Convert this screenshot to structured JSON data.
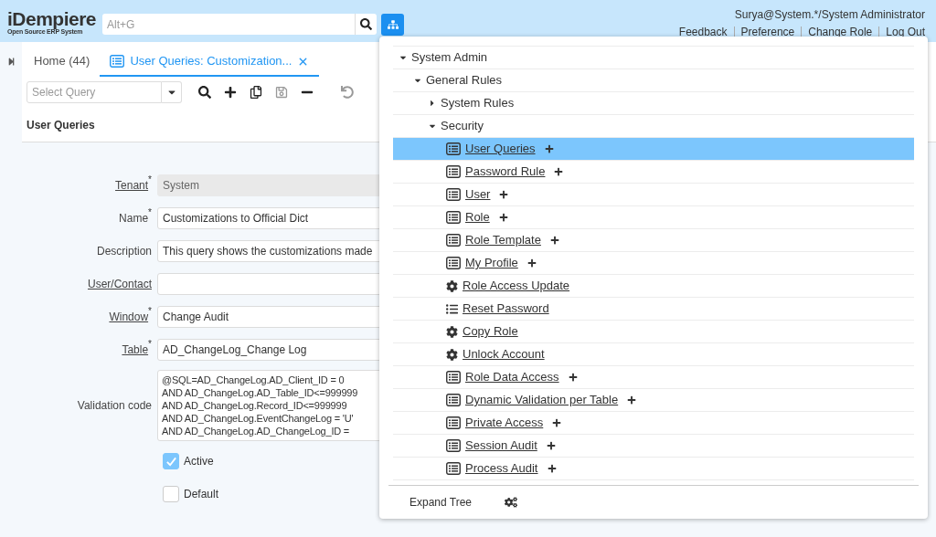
{
  "header": {
    "logo": "iDempiere",
    "logo_subtitle": "Open Source ERP System",
    "search": {
      "placeholder": "Alt+G"
    },
    "user": "Surya@System.*/System Administrator",
    "links": [
      "Feedback",
      "Preference",
      "Change Role",
      "Log Out"
    ]
  },
  "tabs": [
    {
      "label": "Home (44)",
      "selected": false,
      "closable": false
    },
    {
      "label": "User Queries: Customization...",
      "selected": true,
      "closable": true
    }
  ],
  "toolbar": {
    "query": {
      "placeholder": "Select Query"
    }
  },
  "form": {
    "title": "User Queries",
    "fields": [
      {
        "kind": "text",
        "label": "Tenant",
        "link": true,
        "mandatory_mark": "*",
        "readonly": true,
        "value": "System"
      },
      {
        "kind": "text",
        "label": "Name",
        "link": false,
        "mandatory_mark": "*",
        "readonly": false,
        "value": "Customizations to Official Dict"
      },
      {
        "kind": "text",
        "label": "Description",
        "link": false,
        "readonly": false,
        "value": "This query shows the customizations made"
      },
      {
        "kind": "text",
        "label": "User/Contact",
        "link": true,
        "readonly": false
      },
      {
        "kind": "text",
        "label": "Window",
        "link": true,
        "mandatory_mark": "*",
        "readonly": false,
        "value": "Change Audit"
      },
      {
        "kind": "text",
        "label": "Table",
        "link": true,
        "mandatory_mark": "*",
        "readonly": false,
        "value": "AD_ChangeLog_Change Log"
      },
      {
        "kind": "textarea",
        "label": "Validation code",
        "link": false,
        "readonly": false,
        "value": "@SQL=AD_ChangeLog.AD_Client_ID = 0\nAND AD_ChangeLog.AD_Table_ID<=999999\nAND AD_ChangeLog.Record_ID<=999999\nAND AD_ChangeLog.EventChangeLog = 'U'\nAND AD_ChangeLog.AD_ChangeLog_ID ="
      },
      {
        "kind": "checkbox",
        "label": "Active",
        "checked": true
      },
      {
        "kind": "checkbox",
        "label": "Default",
        "checked": false
      }
    ]
  },
  "menu_tree": {
    "items": [
      {
        "kind": "folder",
        "label": "System Admin",
        "expanded": true,
        "children": [
          {
            "kind": "folder",
            "label": "General Rules",
            "expanded": true,
            "children": [
              {
                "kind": "folder",
                "label": "System Rules",
                "expanded": false
              },
              {
                "kind": "folder",
                "label": "Security",
                "expanded": true,
                "children": [
                  {
                    "kind": "window",
                    "label": "User Queries",
                    "selected": true
                  },
                  {
                    "kind": "window",
                    "label": "Password Rule",
                    "selected": false
                  },
                  {
                    "kind": "window",
                    "label": "User",
                    "selected": false
                  },
                  {
                    "kind": "window",
                    "label": "Role",
                    "selected": false
                  },
                  {
                    "kind": "window",
                    "label": "Role Template",
                    "selected": false
                  },
                  {
                    "kind": "window",
                    "label": "My Profile",
                    "selected": false
                  },
                  {
                    "kind": "process",
                    "label": "Role Access Update",
                    "selected": false
                  },
                  {
                    "kind": "report",
                    "label": "Reset Password",
                    "selected": false
                  },
                  {
                    "kind": "process",
                    "label": "Copy Role",
                    "selected": false
                  },
                  {
                    "kind": "process",
                    "label": "Unlock Account",
                    "selected": false
                  },
                  {
                    "kind": "window",
                    "label": "Role Data Access",
                    "selected": false
                  },
                  {
                    "kind": "window",
                    "label": "Dynamic Validation per Table",
                    "selected": false
                  },
                  {
                    "kind": "window",
                    "label": "Private Access",
                    "selected": false
                  },
                  {
                    "kind": "window",
                    "label": "Session Audit",
                    "selected": false
                  },
                  {
                    "kind": "window",
                    "label": "Process Audit",
                    "selected": false
                  }
                ]
              }
            ]
          }
        ]
      }
    ],
    "footer": {
      "expand_label": "Expand Tree"
    }
  }
}
